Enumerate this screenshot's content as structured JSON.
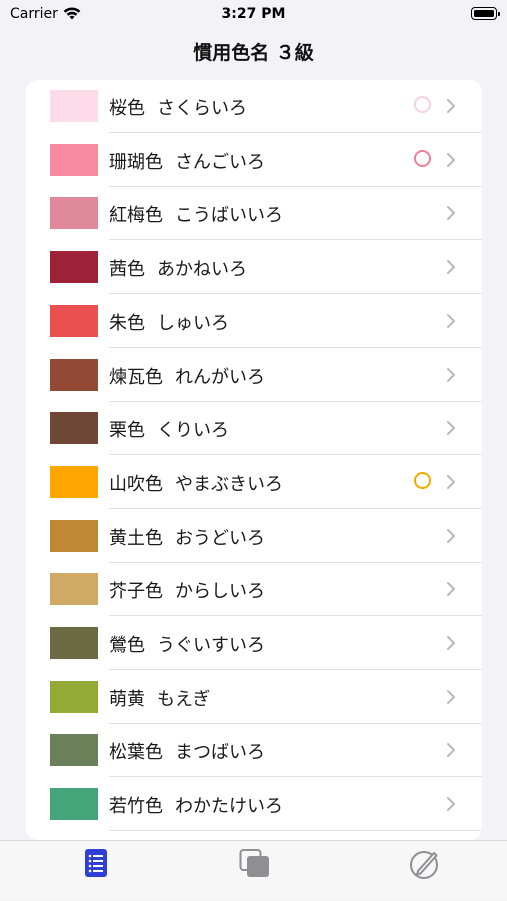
{
  "status_bar": {
    "carrier": "Carrier",
    "time": "3:27 PM"
  },
  "nav": {
    "title": "慣用色名 ３級"
  },
  "colors": [
    {
      "kanji": "桜色",
      "kana": "さくらいろ",
      "swatch": "#fddbe9",
      "circle": "#f9d0df"
    },
    {
      "kanji": "珊瑚色",
      "kana": "さんごいろ",
      "swatch": "#f78a9f",
      "circle": "#ee7f97"
    },
    {
      "kanji": "紅梅色",
      "kana": "こうばいいろ",
      "swatch": "#e0899a",
      "circle": null
    },
    {
      "kanji": "茜色",
      "kana": "あかねいろ",
      "swatch": "#9e2238",
      "circle": null
    },
    {
      "kanji": "朱色",
      "kana": "しゅいろ",
      "swatch": "#ea5050",
      "circle": null
    },
    {
      "kanji": "煉瓦色",
      "kana": "れんがいろ",
      "swatch": "#924a35",
      "circle": null
    },
    {
      "kanji": "栗色",
      "kana": "くりいろ",
      "swatch": "#6e4737",
      "circle": null
    },
    {
      "kanji": "山吹色",
      "kana": "やまぶきいろ",
      "swatch": "#ffa500",
      "circle": "#f5a800"
    },
    {
      "kanji": "黄土色",
      "kana": "おうどいろ",
      "swatch": "#bf8834",
      "circle": null
    },
    {
      "kanji": "芥子色",
      "kana": "からしいろ",
      "swatch": "#d0a965",
      "circle": null
    },
    {
      "kanji": "鶯色",
      "kana": "うぐいすいろ",
      "swatch": "#6b6a43",
      "circle": null
    },
    {
      "kanji": "萌黄",
      "kana": "もえぎ",
      "swatch": "#93aa36",
      "circle": null
    },
    {
      "kanji": "松葉色",
      "kana": "まつばいろ",
      "swatch": "#6a8059",
      "circle": null
    },
    {
      "kanji": "若竹色",
      "kana": "わかたけいろ",
      "swatch": "#44a47a",
      "circle": null
    }
  ],
  "tabs": [
    {
      "icon": "list-icon",
      "active": true
    },
    {
      "icon": "cards-icon",
      "active": false
    },
    {
      "icon": "quiz-icon",
      "active": false
    }
  ],
  "accent": "#2f3fd6"
}
